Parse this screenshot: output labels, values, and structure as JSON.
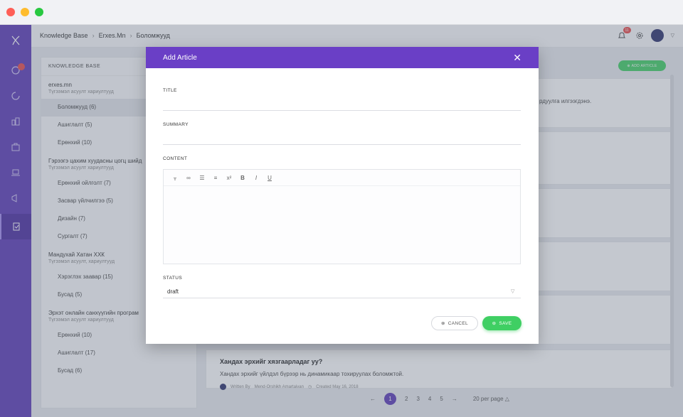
{
  "header": {
    "breadcrumb": [
      "Knowledge Base",
      "Erxes.Mn",
      "Боломжууд"
    ],
    "notification_count": "11"
  },
  "kb_panel": {
    "heading": "KNOWLEDGE BASE",
    "groups": [
      {
        "title": "erxes.mn",
        "subtitle": "Түгээмэл асуулт хариултууд",
        "items": [
          "Боломжууд (6)",
          "Ашиглалт (5)",
          "Ерөнхий (10)"
        ]
      },
      {
        "title": "Гэрээгэ цахим хуудасны цогц шийд",
        "subtitle": "Түгээмэл асуулт хариултууд",
        "items": [
          "Ерөнхий ойлголт (7)",
          "Засвар үйлчилгээ (5)",
          "Дизайн (7)",
          "Сургалт (7)"
        ]
      },
      {
        "title": "Мандухай Хатан ХХК",
        "subtitle": "Түгээмэл асуулт, хариултууд",
        "items": [
          "Хэрэглэх заавар (15)",
          "Бусад (5)"
        ]
      },
      {
        "title": "Эрхэт онлайн санхүүгийн програм",
        "subtitle": "Түгээмэл асуулт хариултууд",
        "items": [
          "Ерөнхий (10)",
          "Ашиглалт (17)",
          "Бусад (6)"
        ]
      }
    ]
  },
  "main": {
    "add_article_label": "ADD ARTICLE",
    "partial_text": "рдуулга илгээгдэнэ.",
    "article": {
      "title": "Хандах эрхийг хязгаарладаг уу?",
      "body": "Хандах эрхийг үйлдэл бүрээр нь динамикаар тохируулах боломжтой.",
      "written_by": "Written By",
      "author": "Mend-Orshikh Amartaivan",
      "created": "Created May 16, 2018"
    },
    "pagination": {
      "pages": [
        "1",
        "2",
        "3",
        "4",
        "5"
      ],
      "per_page": "20 per page"
    }
  },
  "modal": {
    "title": "Add Article",
    "title_label": "TITLE",
    "summary_label": "SUMMARY",
    "content_label": "CONTENT",
    "toolbar": [
      "heading-icon",
      "link-icon",
      "bulleted-list-icon",
      "numbered-list-icon",
      "superscript-icon",
      "bold-icon",
      "italic-icon",
      "underline-icon"
    ],
    "status_label": "STATUS",
    "status_value": "draft",
    "cancel_label": "CANCEL",
    "save_label": "SAVE"
  },
  "colors": {
    "sidebar": "#5b39b6",
    "modal_header": "#6a3fc6",
    "accent_green": "#3fcf63"
  }
}
